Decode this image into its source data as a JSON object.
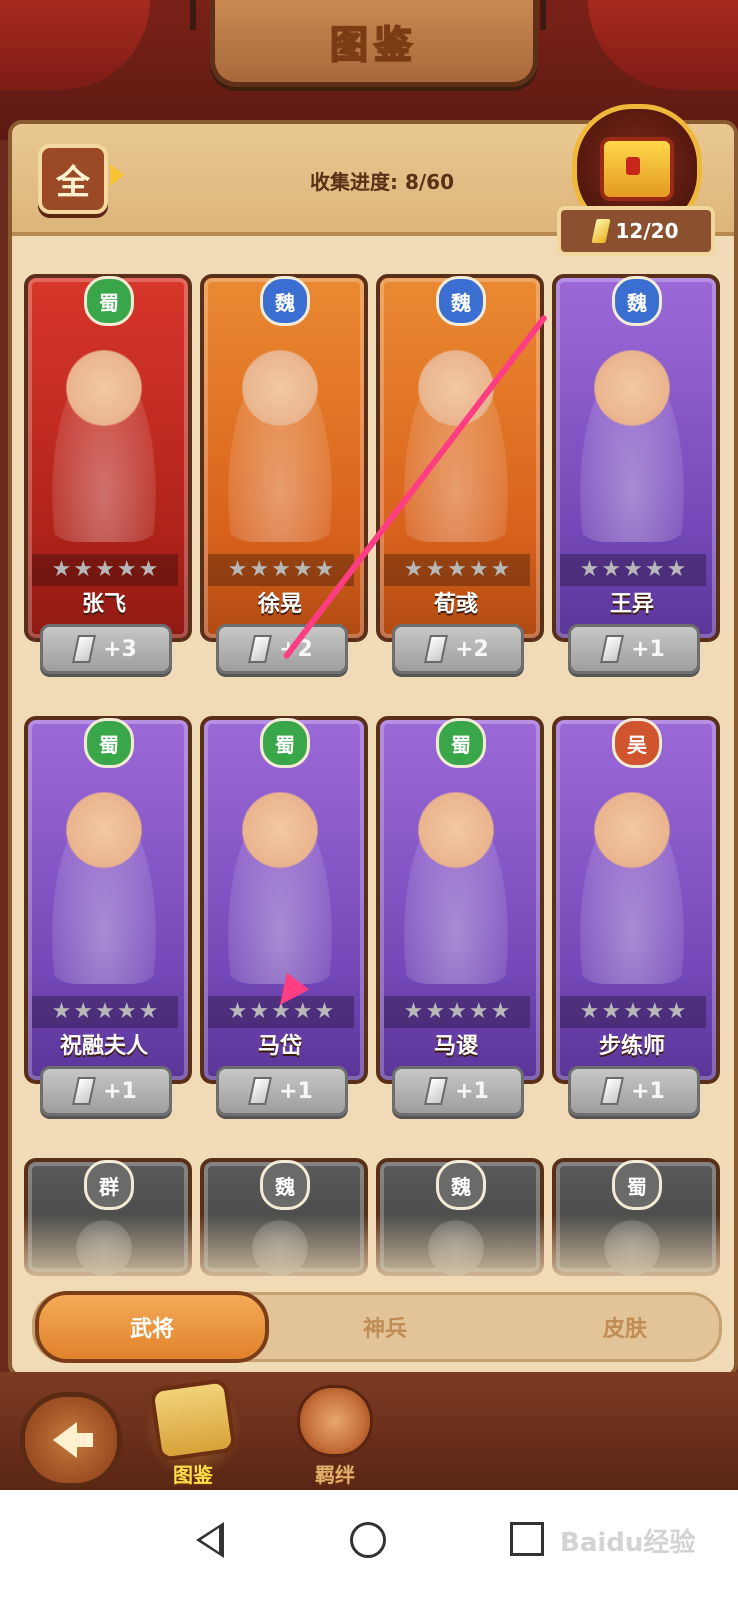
{
  "title": "图鉴",
  "header": {
    "filter_label": "全",
    "progress_text": "收集进度: 8/60",
    "chest_count": "12/20"
  },
  "cards": [
    {
      "faction": "蜀",
      "name": "张飞",
      "shards": "+3",
      "stars": 5
    },
    {
      "faction": "魏",
      "name": "徐晃",
      "shards": "+2",
      "stars": 5
    },
    {
      "faction": "魏",
      "name": "荀彧",
      "shards": "+2",
      "stars": 5
    },
    {
      "faction": "魏",
      "name": "王异",
      "shards": "+1",
      "stars": 5
    },
    {
      "faction": "蜀",
      "name": "祝融夫人",
      "shards": "+1",
      "stars": 5
    },
    {
      "faction": "蜀",
      "name": "马岱",
      "shards": "+1",
      "stars": 5
    },
    {
      "faction": "蜀",
      "name": "马谡",
      "shards": "+1",
      "stars": 5
    },
    {
      "faction": "吴",
      "name": "步练师",
      "shards": "+1",
      "stars": 5
    },
    {
      "faction": "群"
    },
    {
      "faction": "魏"
    },
    {
      "faction": "魏"
    },
    {
      "faction": "蜀"
    }
  ],
  "tabs": [
    "武将",
    "神兵",
    "皮肤"
  ],
  "active_tab": "武将",
  "bottom_nav": {
    "items": [
      "图鉴",
      "羁绊"
    ],
    "active": "图鉴"
  },
  "watermark": "Baidu经验",
  "colors": {
    "shu_faction": "#3aa64a",
    "wei_faction": "#3a6fd1",
    "wu_faction": "#d0542e",
    "qun_faction": "#777777",
    "annotation_arrow": "#ff3d82",
    "active_tab": "#e1822e"
  }
}
